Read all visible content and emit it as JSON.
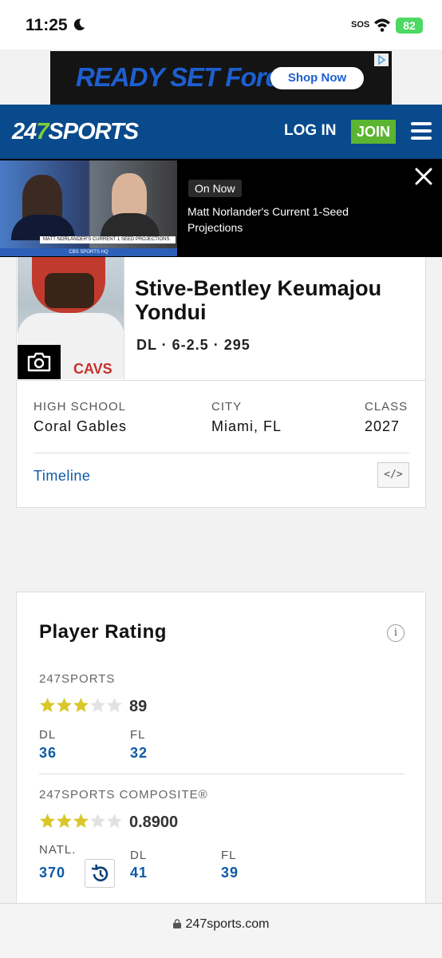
{
  "status_bar": {
    "time": "11:25",
    "sos": "SOS",
    "battery": "82"
  },
  "ad": {
    "headline": "READY SET Ford",
    "cta": "Shop Now"
  },
  "header": {
    "logo_prefix": "24",
    "logo_seven": "7",
    "logo_suffix": "SPORTS",
    "login": "LOG IN",
    "join": "JOIN"
  },
  "video": {
    "badge": "On Now",
    "title": "Matt Norlander's Current 1-Seed Projections",
    "thumb_caption": "MATT NORLANDER'S CURRENT 1 SEED PROJECTIONS",
    "thumb_footer": "CBS SPORTS HQ"
  },
  "player": {
    "name": "Stive-Bentley Keumajou Yondui",
    "meta": "DL · 6-2.5 · 295",
    "high_school_label": "HIGH SCHOOL",
    "high_school": "Coral Gables",
    "city_label": "CITY",
    "city": "Miami, FL",
    "class_label": "CLASS",
    "class": "2027",
    "timeline": "Timeline",
    "embed": "</>",
    "jersey_text": "CAVS"
  },
  "rating": {
    "title": "Player Rating",
    "info": "i",
    "sports247": {
      "label": "247SPORTS",
      "stars": 3,
      "score": "89",
      "pos_label": "DL",
      "pos_rank": "36",
      "state_label": "FL",
      "state_rank": "32"
    },
    "composite": {
      "label": "247SPORTS COMPOSITE®",
      "stars": 3,
      "score": "0.8900",
      "natl_label": "NATL.",
      "natl_rank": "370",
      "pos_label": "DL",
      "pos_rank": "41",
      "state_label": "FL",
      "state_rank": "39"
    }
  },
  "urlbar": {
    "url": "247sports.com"
  },
  "colors": {
    "brand_blue": "#084a8c",
    "join_green": "#5cb531",
    "link_blue": "#0d5aa7",
    "star_gold": "#d9c72a"
  }
}
